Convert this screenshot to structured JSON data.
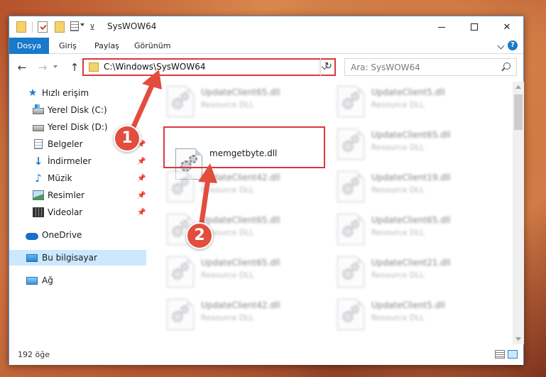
{
  "window": {
    "title": "SysWOW64",
    "controls": {
      "minimize": "",
      "maximize": "",
      "close": "✕"
    }
  },
  "ribbon": {
    "tabs": [
      "Dosya",
      "Giriş",
      "Paylaş",
      "Görünüm"
    ],
    "help": "?"
  },
  "navigation": {
    "back": "←",
    "forward": "→",
    "up": "↑",
    "address": "C:\\Windows\\SysWOW64",
    "refresh": "↻",
    "search_placeholder": "Ara: SysWOW64"
  },
  "sidebar": {
    "items": [
      {
        "label": "Hızlı erişim",
        "icon": "star-icon"
      },
      {
        "label": "Yerel Disk (C:)",
        "icon": "drive-c-icon"
      },
      {
        "label": "Yerel Disk (D:)",
        "icon": "drive-d-icon"
      },
      {
        "label": "Belgeler",
        "icon": "documents-icon"
      },
      {
        "label": "İndirmeler",
        "icon": "downloads-icon"
      },
      {
        "label": "Müzik",
        "icon": "music-icon"
      },
      {
        "label": "Resimler",
        "icon": "pictures-icon"
      },
      {
        "label": "Videolar",
        "icon": "videos-icon"
      },
      {
        "label": "OneDrive",
        "icon": "onedrive-icon"
      },
      {
        "label": "Bu bilgisayar",
        "icon": "this-pc-icon"
      },
      {
        "label": "Ağ",
        "icon": "network-icon"
      }
    ],
    "pin": "📌"
  },
  "files": [
    {
      "name": "UpdateClient65.dll",
      "type": "Resource DLL"
    },
    {
      "name": "UpdateClient5.dll",
      "type": "Resource DLL"
    },
    {
      "name": "memgetbyte.dll",
      "type": ""
    },
    {
      "name": "UpdateClient65.dll",
      "type": "Resource DLL"
    },
    {
      "name": "UpdateClient42.dll",
      "type": "Resource DLL"
    },
    {
      "name": "UpdateClient19.dll",
      "type": "Resource DLL"
    },
    {
      "name": "UpdateClient65.dll",
      "type": "Resource DLL"
    },
    {
      "name": "UpdateClient65.dll",
      "type": "Resource DLL"
    },
    {
      "name": "UpdateClient65.dll",
      "type": "Resource DLL"
    },
    {
      "name": "UpdateClient21.dll",
      "type": "Resource DLL"
    },
    {
      "name": "UpdateClient42.dll",
      "type": "Resource DLL"
    },
    {
      "name": "UpdateClient5.dll",
      "type": "Resource DLL"
    }
  ],
  "status": {
    "item_count": "192 öğe"
  },
  "annotations": {
    "step1": "1",
    "step2": "2",
    "color": "#e24d3d"
  }
}
